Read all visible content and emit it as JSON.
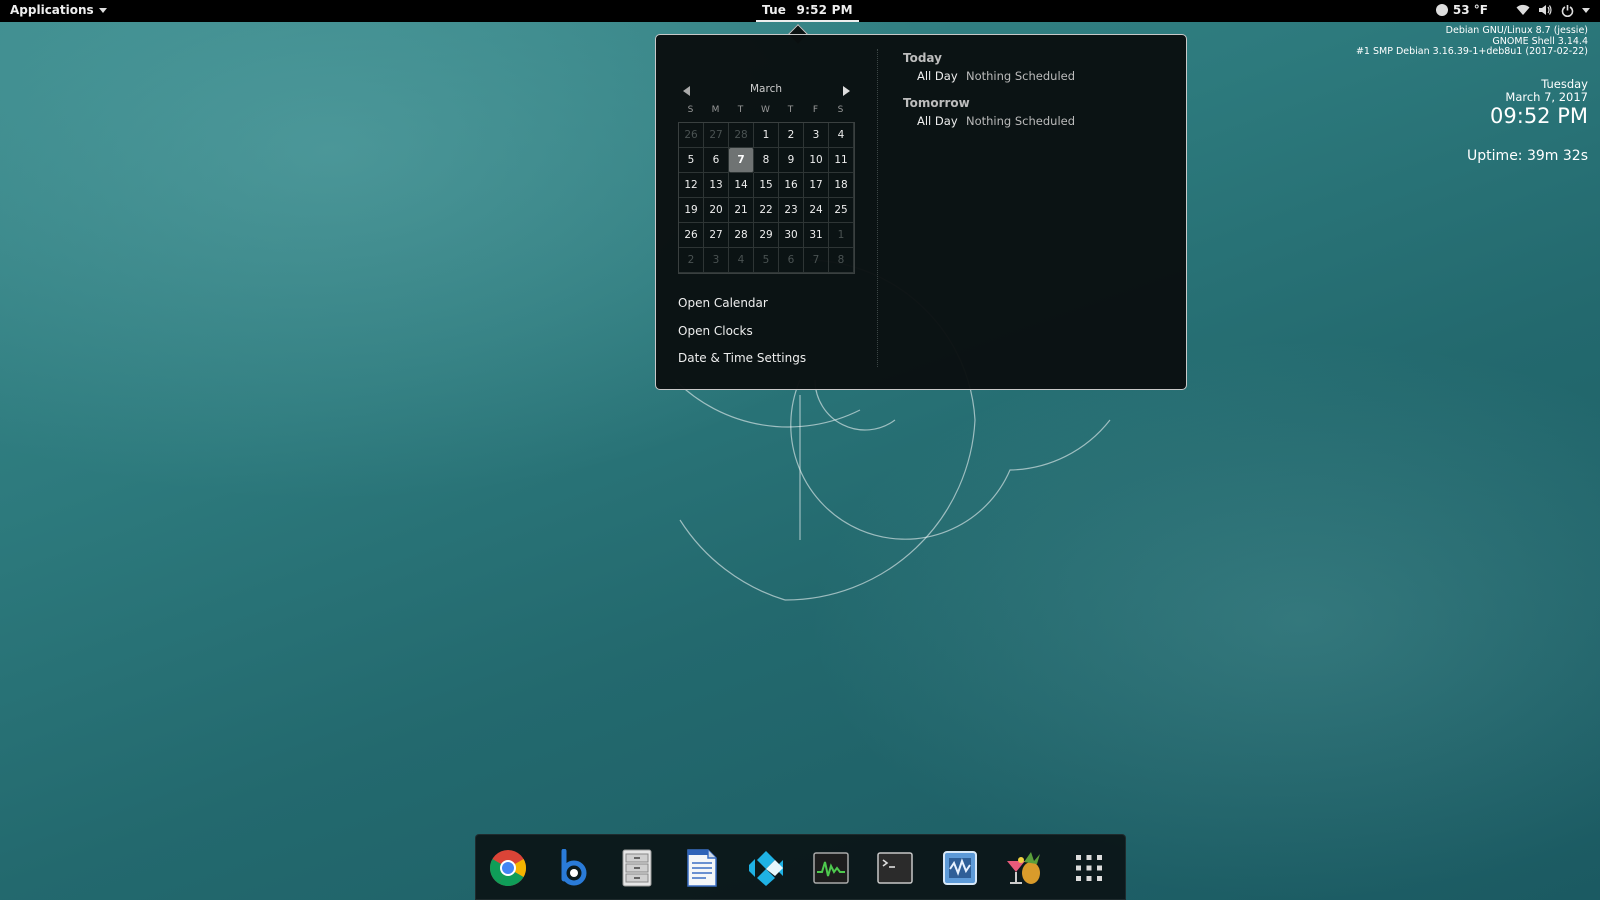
{
  "topbar": {
    "applications_label": "Applications",
    "clock_day": "Tue",
    "clock_time": "9:52 PM",
    "weather": "53 °F"
  },
  "desktop_info": {
    "os": "Debian GNU/Linux 8.7 (jessie)",
    "shell": "GNOME Shell 3.14.4",
    "kernel": "#1 SMP Debian 3.16.39-1+deb8u1 (2017-02-22)",
    "weekday": "Tuesday",
    "date": "March 7, 2017",
    "time": "09:52 PM",
    "uptime": "Uptime: 39m 32s"
  },
  "calendar": {
    "month": "March",
    "weekdays": [
      "S",
      "M",
      "T",
      "W",
      "T",
      "F",
      "S"
    ],
    "days": [
      {
        "d": "26",
        "out": true
      },
      {
        "d": "27",
        "out": true
      },
      {
        "d": "28",
        "out": true
      },
      {
        "d": "1"
      },
      {
        "d": "2"
      },
      {
        "d": "3"
      },
      {
        "d": "4"
      },
      {
        "d": "5"
      },
      {
        "d": "6"
      },
      {
        "d": "7",
        "today": true
      },
      {
        "d": "8"
      },
      {
        "d": "9"
      },
      {
        "d": "10"
      },
      {
        "d": "11"
      },
      {
        "d": "12"
      },
      {
        "d": "13"
      },
      {
        "d": "14"
      },
      {
        "d": "15"
      },
      {
        "d": "16"
      },
      {
        "d": "17"
      },
      {
        "d": "18"
      },
      {
        "d": "19"
      },
      {
        "d": "20"
      },
      {
        "d": "21"
      },
      {
        "d": "22"
      },
      {
        "d": "23"
      },
      {
        "d": "24"
      },
      {
        "d": "25"
      },
      {
        "d": "26"
      },
      {
        "d": "27"
      },
      {
        "d": "28"
      },
      {
        "d": "29"
      },
      {
        "d": "30"
      },
      {
        "d": "31"
      },
      {
        "d": "1",
        "out": true
      },
      {
        "d": "2",
        "out": true
      },
      {
        "d": "3",
        "out": true
      },
      {
        "d": "4",
        "out": true
      },
      {
        "d": "5",
        "out": true
      },
      {
        "d": "6",
        "out": true
      },
      {
        "d": "7",
        "out": true
      },
      {
        "d": "8",
        "out": true
      }
    ],
    "links": {
      "open_calendar": "Open Calendar",
      "open_clocks": "Open Clocks",
      "date_time_settings": "Date & Time Settings"
    }
  },
  "events": {
    "today": {
      "title": "Today",
      "when": "All Day",
      "what": "Nothing Scheduled"
    },
    "tomorrow": {
      "title": "Tomorrow",
      "when": "All Day",
      "what": "Nothing Scheduled"
    }
  },
  "dock": {
    "items": [
      "chrome-icon",
      "bluefish-icon",
      "file-cabinet-icon",
      "text-document-icon",
      "kodi-icon",
      "system-monitor-icon",
      "terminal-icon",
      "activity-monitor-icon",
      "cocktail-icon",
      "app-grid-icon"
    ]
  }
}
